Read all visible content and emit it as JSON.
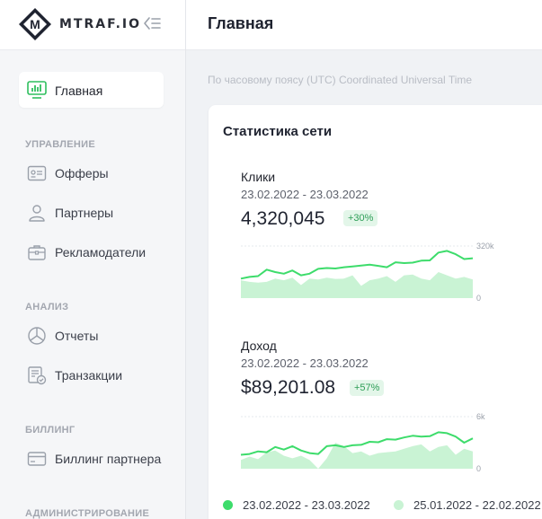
{
  "brand": {
    "name": "MTRAF.IO",
    "logo_letter": "M"
  },
  "header": {
    "title": "Главная"
  },
  "timezone_note": "По часовому поясу (UTC) Coordinated Universal Time",
  "sidebar": {
    "active": {
      "label": "Главная",
      "icon": "monitor-chart-icon"
    },
    "sections": [
      {
        "title": "УПРАВЛЕНИЕ",
        "items": [
          {
            "label": "Офферы",
            "icon": "id-card-icon"
          },
          {
            "label": "Партнеры",
            "icon": "user-icon"
          },
          {
            "label": "Рекламодатели",
            "icon": "briefcase-icon"
          }
        ]
      },
      {
        "title": "АНАЛИЗ",
        "items": [
          {
            "label": "Отчеты",
            "icon": "pie-chart-icon"
          },
          {
            "label": "Транзакции",
            "icon": "receipt-check-icon"
          }
        ]
      },
      {
        "title": "БИЛЛИНГ",
        "items": [
          {
            "label": "Биллинг партнера",
            "icon": "credit-card-icon"
          }
        ]
      },
      {
        "title": "АДМИНИСТРИРОВАНИЕ",
        "items": []
      }
    ]
  },
  "stats": {
    "title": "Статистика сети",
    "metrics": [
      {
        "label": "Клики",
        "range": "23.02.2022 - 23.03.2022",
        "value": "4,320,045",
        "change": "+30%"
      },
      {
        "label": "Доход",
        "range": "23.02.2022 - 23.03.2022",
        "value": "$89,201.08",
        "change": "+57%"
      }
    ],
    "legend": [
      {
        "label": "23.02.2022 - 23.03.2022",
        "color": "#3ddc6b"
      },
      {
        "label": "25.01.2022 - 22.02.2022",
        "color": "#c9f3d4"
      }
    ]
  },
  "colors": {
    "line": "#3ddc6b",
    "area": "#c9f3d4",
    "badge_text": "#2e9e57",
    "badge_bg": "#e3f6e9"
  },
  "chart_data": [
    {
      "type": "line",
      "ylim": [
        0,
        320000
      ],
      "y_ticks": [
        "0",
        "320k"
      ],
      "series": [
        {
          "name": "23.02.2022 - 23.03.2022",
          "values": [
            120000,
            130000,
            135000,
            175000,
            160000,
            150000,
            170000,
            140000,
            150000,
            180000,
            185000,
            182000,
            190000,
            195000,
            200000,
            205000,
            198000,
            190000,
            220000,
            215000,
            218000,
            230000,
            232000,
            280000,
            290000,
            270000,
            240000,
            245000
          ]
        },
        {
          "name": "25.01.2022 - 22.02.2022",
          "values": [
            110000,
            100000,
            95000,
            100000,
            120000,
            110000,
            125000,
            80000,
            120000,
            115000,
            125000,
            118000,
            120000,
            140000,
            75000,
            110000,
            120000,
            135000,
            100000,
            140000,
            145000,
            120000,
            110000,
            160000,
            140000,
            120000,
            130000,
            115000
          ]
        }
      ]
    },
    {
      "type": "line",
      "ylim": [
        0,
        6000
      ],
      "y_ticks": [
        "0",
        "6k"
      ],
      "series": [
        {
          "name": "23.02.2022 - 23.03.2022",
          "values": [
            1600,
            1700,
            2000,
            1900,
            2500,
            2200,
            2600,
            2100,
            1800,
            1700,
            2600,
            2700,
            2500,
            2700,
            2750,
            3100,
            3050,
            3400,
            3350,
            3600,
            3800,
            3700,
            3750,
            4200,
            4100,
            3700,
            3000,
            3500
          ]
        },
        {
          "name": "25.01.2022 - 22.02.2022",
          "values": [
            1000,
            1400,
            1100,
            1900,
            2100,
            1500,
            1200,
            1500,
            1000,
            0,
            1200,
            3000,
            2600,
            1800,
            2000,
            1500,
            1800,
            1900,
            2000,
            2300,
            2600,
            2800,
            2000,
            2500,
            2700,
            1600,
            2300,
            2000
          ]
        }
      ]
    }
  ]
}
